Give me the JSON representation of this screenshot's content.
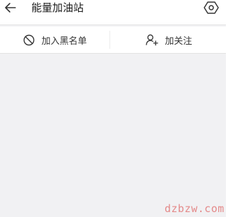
{
  "header": {
    "back_icon": "arrow-left-icon",
    "title": "能量加油站",
    "settings_icon": "hexagon-settings-icon"
  },
  "actions": {
    "blacklist": {
      "icon": "block-circle-icon",
      "label": "加入黑名单"
    },
    "follow": {
      "icon": "add-user-icon",
      "label": "加关注"
    }
  },
  "watermark": "dzbzw.com",
  "colors": {
    "background": "#f1f1f3",
    "bar": "#ffffff",
    "icon": "#333333",
    "watermark": "#e48a8a"
  }
}
